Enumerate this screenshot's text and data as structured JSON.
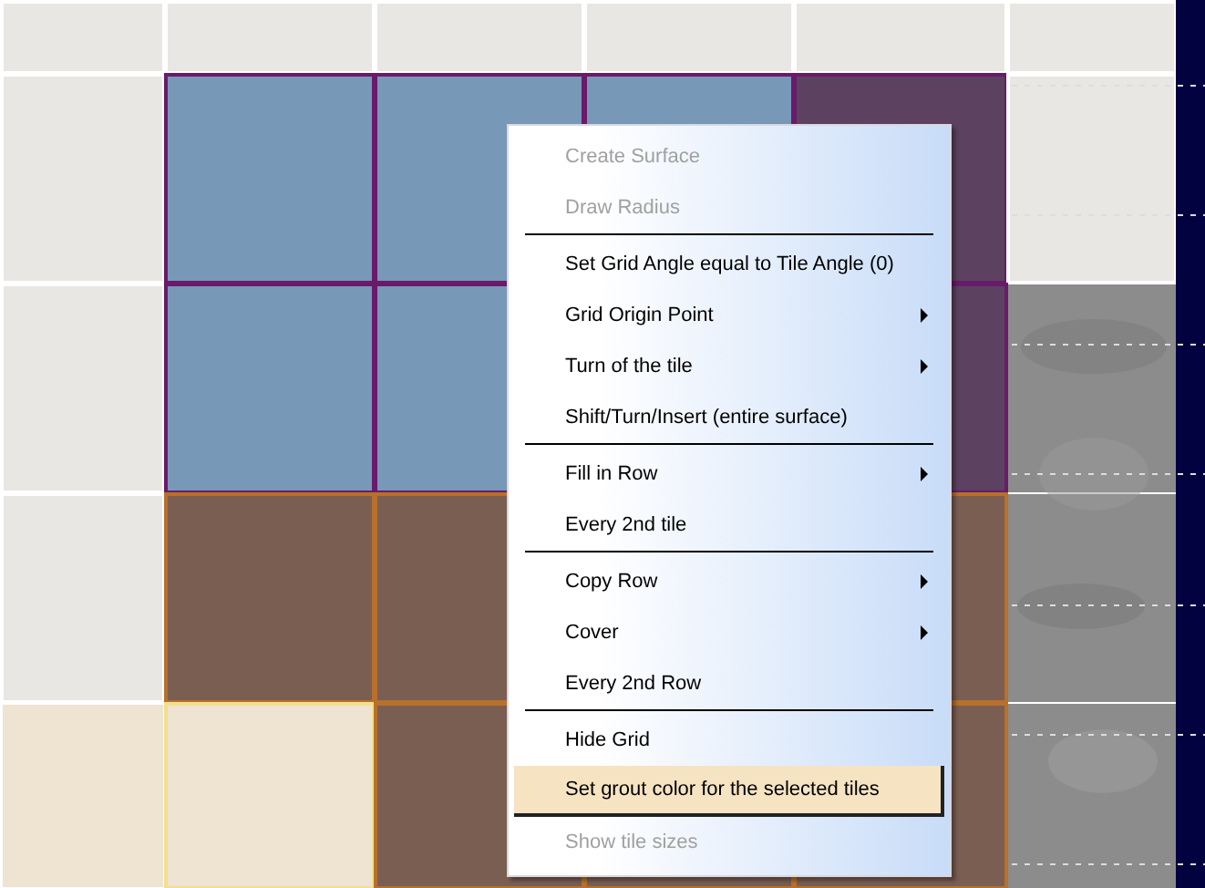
{
  "context_menu": {
    "items": [
      {
        "kind": "item",
        "label": "Create Surface",
        "disabled": true,
        "submenu": false,
        "selected": false
      },
      {
        "kind": "item",
        "label": "Draw Radius",
        "disabled": true,
        "submenu": false,
        "selected": false
      },
      {
        "kind": "separator"
      },
      {
        "kind": "item",
        "label": "Set Grid Angle equal to Tile Angle (0)",
        "disabled": false,
        "submenu": false,
        "selected": false
      },
      {
        "kind": "item",
        "label": "Grid Origin Point",
        "disabled": false,
        "submenu": true,
        "selected": false
      },
      {
        "kind": "item",
        "label": "Turn of the tile",
        "disabled": false,
        "submenu": true,
        "selected": false
      },
      {
        "kind": "item",
        "label": "Shift/Turn/Insert (entire surface)",
        "disabled": false,
        "submenu": false,
        "selected": false
      },
      {
        "kind": "separator"
      },
      {
        "kind": "item",
        "label": "Fill in Row",
        "disabled": false,
        "submenu": true,
        "selected": false
      },
      {
        "kind": "item",
        "label": "Every 2nd tile",
        "disabled": false,
        "submenu": false,
        "selected": false
      },
      {
        "kind": "separator"
      },
      {
        "kind": "item",
        "label": "Copy Row",
        "disabled": false,
        "submenu": true,
        "selected": false
      },
      {
        "kind": "item",
        "label": "Cover",
        "disabled": false,
        "submenu": true,
        "selected": false
      },
      {
        "kind": "item",
        "label": "Every 2nd Row",
        "disabled": false,
        "submenu": false,
        "selected": false
      },
      {
        "kind": "separator"
      },
      {
        "kind": "item",
        "label": "Hide Grid",
        "disabled": false,
        "submenu": false,
        "selected": false
      },
      {
        "kind": "item",
        "label": "Set grout color for the selected tiles",
        "disabled": false,
        "submenu": false,
        "selected": true
      },
      {
        "kind": "item",
        "label": "Show tile sizes",
        "disabled": true,
        "submenu": false,
        "selected": false
      }
    ]
  }
}
